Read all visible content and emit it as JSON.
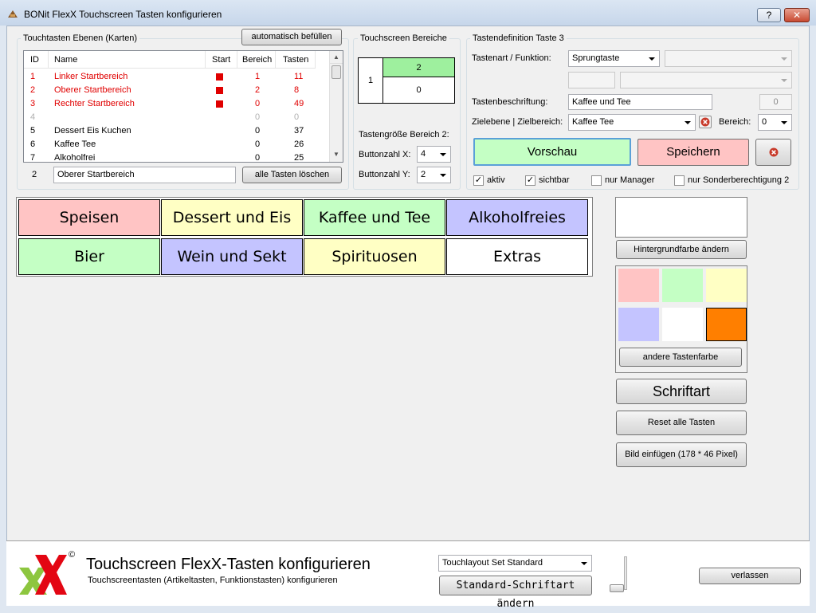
{
  "window": {
    "title": "BONit FlexX Touchscreen Tasten konfigurieren",
    "help_label": "?",
    "close_label": "✕"
  },
  "ebenen": {
    "group_label": "Touchtasten Ebenen (Karten)",
    "autofill_label": "automatisch befüllen",
    "columns": [
      "ID",
      "Name",
      "Start",
      "Bereich",
      "Tasten"
    ],
    "rows": [
      {
        "id": "1",
        "name": "Linker Startbereich",
        "start": true,
        "bereich": "1",
        "tasten": "11",
        "style": "red"
      },
      {
        "id": "2",
        "name": "Oberer Startbereich",
        "start": true,
        "bereich": "2",
        "tasten": "8",
        "style": "red"
      },
      {
        "id": "3",
        "name": "Rechter Startbereich",
        "start": true,
        "bereich": "0",
        "tasten": "49",
        "style": "red"
      },
      {
        "id": "4",
        "name": "",
        "start": false,
        "bereich": "0",
        "tasten": "0",
        "style": "grey"
      },
      {
        "id": "5",
        "name": "Dessert Eis Kuchen",
        "start": false,
        "bereich": "0",
        "tasten": "37",
        "style": "normal"
      },
      {
        "id": "6",
        "name": "Kaffee Tee",
        "start": false,
        "bereich": "0",
        "tasten": "26",
        "style": "normal"
      },
      {
        "id": "7",
        "name": "Alkoholfrei",
        "start": false,
        "bereich": "0",
        "tasten": "25",
        "style": "normal"
      }
    ],
    "selected_id": "2",
    "selected_name": "Oberer Startbereich",
    "delete_all_label": "alle Tasten löschen"
  },
  "bereiche": {
    "group_label": "Touchscreen Bereiche",
    "area1": "1",
    "area2": "2",
    "area0": "0",
    "size_label": "Tastengröße Bereich 2:",
    "x_label": "Buttonzahl X:",
    "x_value": "4",
    "y_label": "Buttonzahl Y:",
    "y_value": "2"
  },
  "definition": {
    "group_label": "Tastendefinition Taste 3",
    "art_label": "Tastenart / Funktion:",
    "art_value": "Sprungtaste",
    "beschriftung_label": "Tastenbeschriftung:",
    "beschriftung_value": "Kaffee und Tee",
    "beschriftung_count": "0",
    "ziel_label": "Zielebene | Zielbereich:",
    "ziel_value": "Kaffee Tee",
    "bereich_label": "Bereich:",
    "bereich_value": "0",
    "preview_label": "Vorschau",
    "save_label": "Speichern",
    "aktiv_label": "aktiv",
    "aktiv": true,
    "sichtbar_label": "sichtbar",
    "sichtbar": true,
    "manager_label": "nur Manager",
    "manager": false,
    "sonder_label": "nur Sonderberechtigung 2",
    "sonder": false,
    "check_mark": "✓"
  },
  "keys": [
    {
      "label": "Speisen",
      "color": "#ffc4c4"
    },
    {
      "label": "Dessert und Eis",
      "color": "#ffffc4"
    },
    {
      "label": "Kaffee und Tee",
      "color": "#c4ffc4"
    },
    {
      "label": "Alkoholfreies",
      "color": "#c4c4ff"
    },
    {
      "label": "Bier",
      "color": "#c4ffc4"
    },
    {
      "label": "Wein und Sekt",
      "color": "#c4c4ff"
    },
    {
      "label": "Spirituosen",
      "color": "#ffffc4"
    },
    {
      "label": "Extras",
      "color": "#ffffff"
    }
  ],
  "colors": {
    "bg_button_label": "Hintergrundfarbe ändern",
    "swatches": [
      "#ffc4c4",
      "#c4ffc4",
      "#ffffc4",
      "#c4c4ff",
      "#ffffff",
      "#ff7f00"
    ],
    "other_color_label": "andere Tastenfarbe",
    "font_label": "Schriftart",
    "reset_label": "Reset alle Tasten",
    "image_label": "Bild einfügen (178 * 46 Pixel)"
  },
  "footer": {
    "logo_mark": "©",
    "title": "Touchscreen FlexX-Tasten konfigurieren",
    "subtitle": "Touchscreentasten (Artikeltasten, Funktionstasten) konfigurieren",
    "layout_value": "Touchlayout Set Standard",
    "std_font_label": "Standard-Schriftart ändern",
    "exit_label": "verlassen"
  }
}
